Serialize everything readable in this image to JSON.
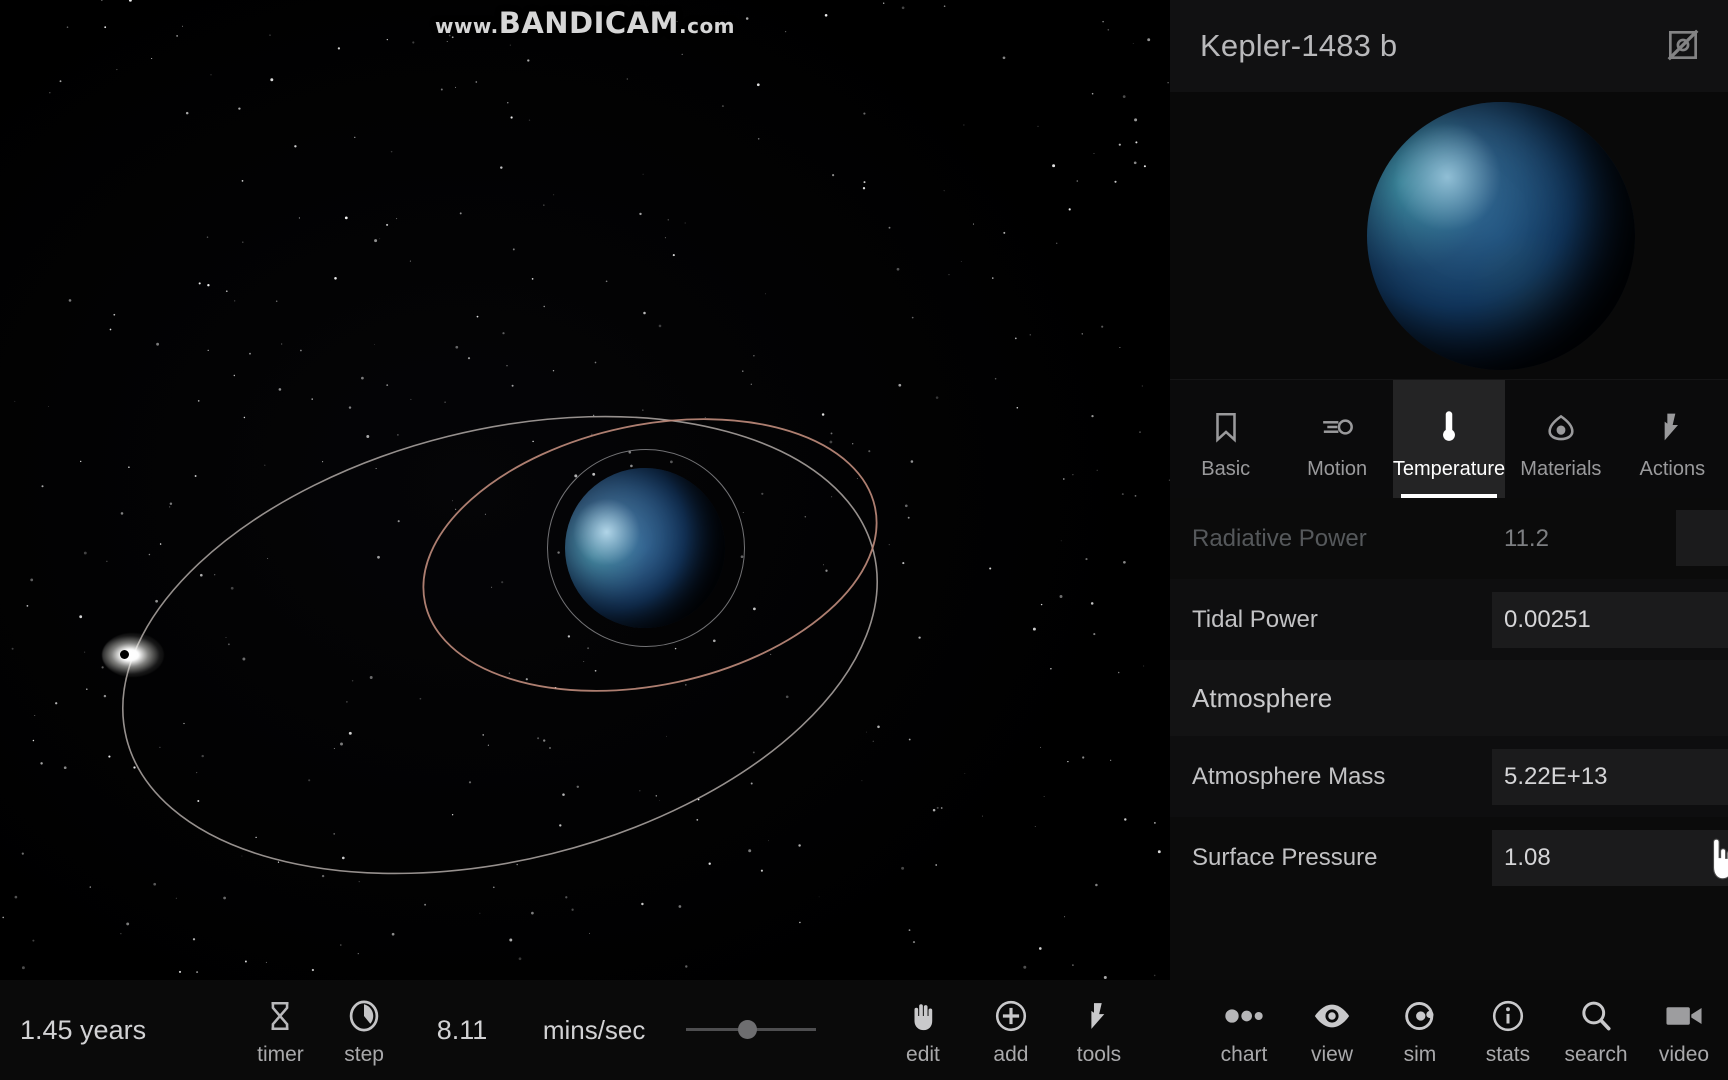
{
  "watermark": {
    "prefix": "www.",
    "brand": "BANDICAM",
    "suffix": ".com"
  },
  "viewport": {
    "name": "orbit-simulation-viewport",
    "selected_body": "Kepler-1483 b",
    "orbit_colors": {
      "inner": "#c08c7c",
      "outer": "#b0a9a6",
      "selection_ring": "#cdcdd2"
    }
  },
  "panel": {
    "title": "Kepler-1483 b",
    "title_icon": "hide-image-icon",
    "preview_label": "planet-preview",
    "tabs": [
      {
        "label": "Basic",
        "icon": "bookmark-icon",
        "active": false
      },
      {
        "label": "Motion",
        "icon": "motion-icon",
        "active": false
      },
      {
        "label": "Temperature",
        "icon": "thermometer-icon",
        "active": true
      },
      {
        "label": "Materials",
        "icon": "droplet-icon",
        "active": false
      },
      {
        "label": "Actions",
        "icon": "lightning-icon",
        "active": false
      }
    ],
    "rows": [
      {
        "label": "Radiative Power",
        "value": "11.2",
        "readonly": true,
        "kind": "row"
      },
      {
        "label": "Tidal Power",
        "value": "0.00251",
        "readonly": false,
        "kind": "row"
      },
      {
        "label": "Atmosphere",
        "value": "",
        "readonly": true,
        "kind": "section"
      },
      {
        "label": "Atmosphere Mass",
        "value": "5.22E+13",
        "readonly": false,
        "kind": "row"
      },
      {
        "label": "Surface Pressure",
        "value": "1.08",
        "readonly": false,
        "kind": "row"
      }
    ]
  },
  "toolbar": {
    "elapsed": "1.45 years",
    "timer_label": "timer",
    "step_label": "step",
    "rate_value": "8.11",
    "rate_unit": "mins/sec",
    "slider_name": "speed-slider",
    "buttons": [
      {
        "label": "edit",
        "icon": "hand-icon"
      },
      {
        "label": "add",
        "icon": "plus-circle-icon"
      },
      {
        "label": "tools",
        "icon": "lightning-icon"
      },
      {
        "label": "chart",
        "icon": "dots-icon"
      },
      {
        "label": "view",
        "icon": "eye-icon"
      },
      {
        "label": "sim",
        "icon": "orbit-icon"
      },
      {
        "label": "stats",
        "icon": "info-icon"
      },
      {
        "label": "search",
        "icon": "magnifier-icon"
      },
      {
        "label": "video",
        "icon": "camera-icon"
      }
    ]
  },
  "colors": {
    "panel_bg": "#0b0b0b",
    "panel_header_bg": "#111112",
    "tab_active_bg": "#242425",
    "input_bg": "#1b1b1c",
    "text_primary": "#d5d5d7",
    "text_muted": "#7d7f82"
  }
}
